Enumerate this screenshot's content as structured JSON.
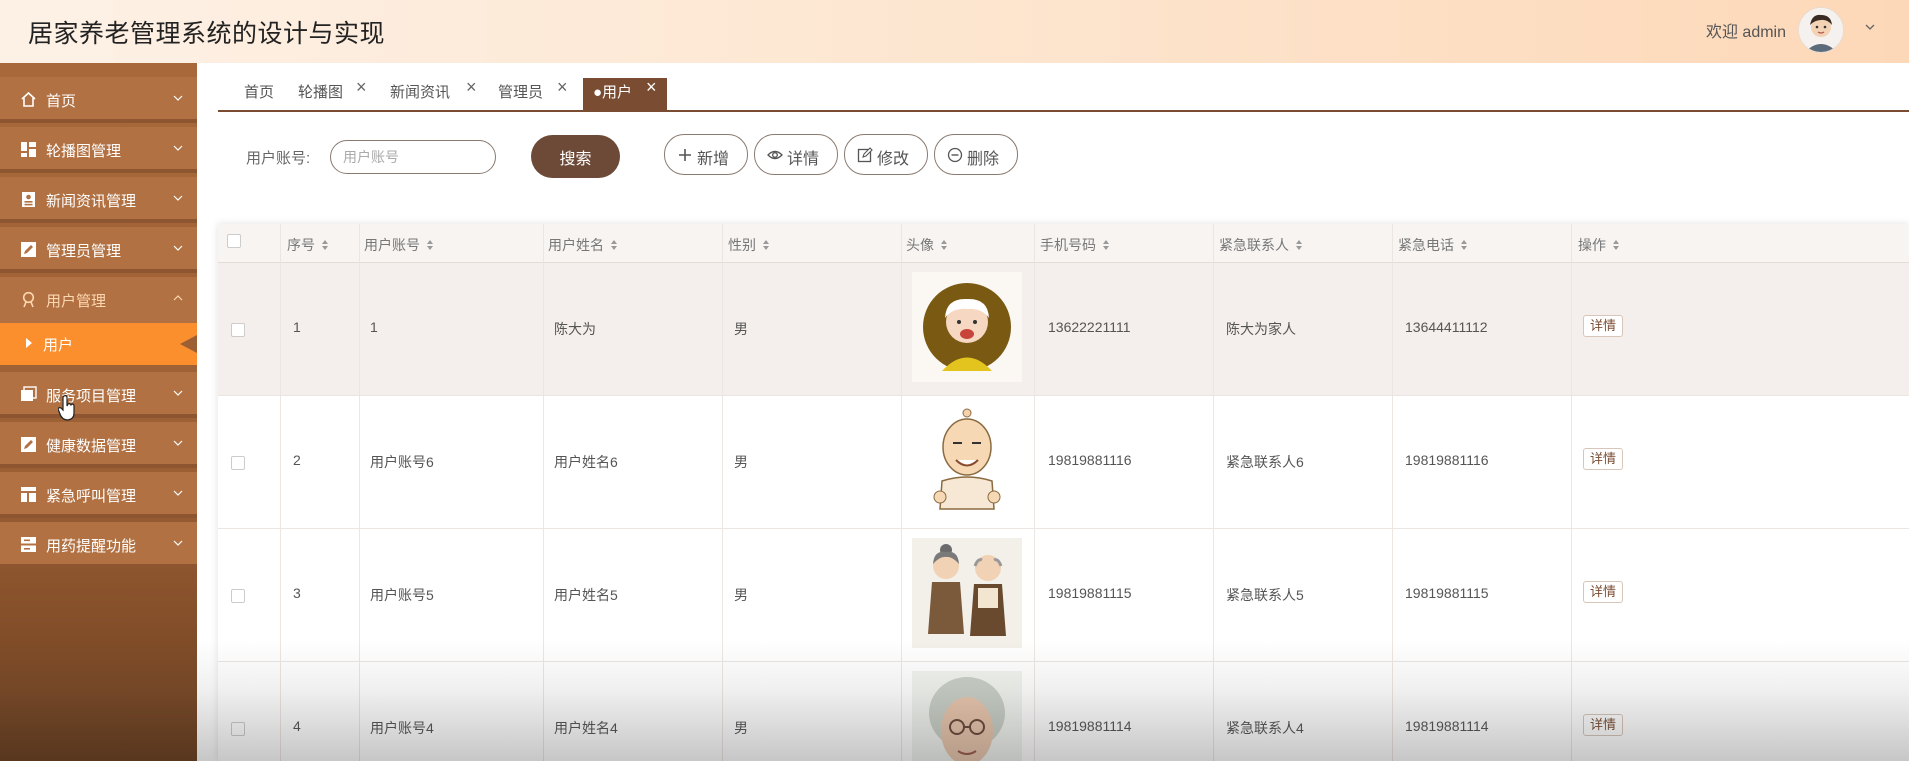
{
  "header": {
    "title": "居家养老管理系统的设计与实现",
    "welcome": "欢迎 admin"
  },
  "sidebar": {
    "items": [
      {
        "label": "首页",
        "icon": "home-icon"
      },
      {
        "label": "轮播图管理",
        "icon": "grid-icon"
      },
      {
        "label": "新闻资讯管理",
        "icon": "news-icon"
      },
      {
        "label": "管理员管理",
        "icon": "edit-icon"
      },
      {
        "label": "用户管理",
        "icon": "user-icon",
        "expanded": true
      },
      {
        "label": "服务项目管理",
        "icon": "folder-icon"
      },
      {
        "label": "健康数据管理",
        "icon": "edit-icon"
      },
      {
        "label": "紧急呼叫管理",
        "icon": "layout-icon"
      },
      {
        "label": "用药提醒功能",
        "icon": "server-icon"
      }
    ],
    "sub_item": "用户"
  },
  "tabs": [
    {
      "label": "首页",
      "closable": false
    },
    {
      "label": "轮播图",
      "closable": true
    },
    {
      "label": "新闻资讯",
      "closable": true
    },
    {
      "label": "管理员",
      "closable": true
    },
    {
      "label": "●用户",
      "closable": true,
      "active": true
    }
  ],
  "search": {
    "label": "用户账号:",
    "placeholder": "用户账号",
    "button": "搜索"
  },
  "actions": {
    "add": "新增",
    "detail": "详情",
    "edit": "修改",
    "delete": "删除"
  },
  "table": {
    "columns": [
      "序号",
      "用户账号",
      "用户姓名",
      "性别",
      "头像",
      "手机号码",
      "紧急联系人",
      "紧急电话",
      "操作"
    ],
    "detail_label": "详情",
    "rows": [
      {
        "no": "1",
        "account": "1",
        "name": "陈大为",
        "gender": "男",
        "phone": "13622221111",
        "contact": "陈大为家人",
        "contact_phone": "13644411112"
      },
      {
        "no": "2",
        "account": "用户账号6",
        "name": "用户姓名6",
        "gender": "男",
        "phone": "19819881116",
        "contact": "紧急联系人6",
        "contact_phone": "19819881116"
      },
      {
        "no": "3",
        "account": "用户账号5",
        "name": "用户姓名5",
        "gender": "男",
        "phone": "19819881115",
        "contact": "紧急联系人5",
        "contact_phone": "19819881115"
      },
      {
        "no": "4",
        "account": "用户账号4",
        "name": "用户姓名4",
        "gender": "男",
        "phone": "19819881114",
        "contact": "紧急联系人4",
        "contact_phone": "19819881114"
      }
    ]
  },
  "colors": {
    "brand_brown": "#7a4d33",
    "sidebar": "#b17142",
    "active_orange": "#fb8f2e"
  }
}
